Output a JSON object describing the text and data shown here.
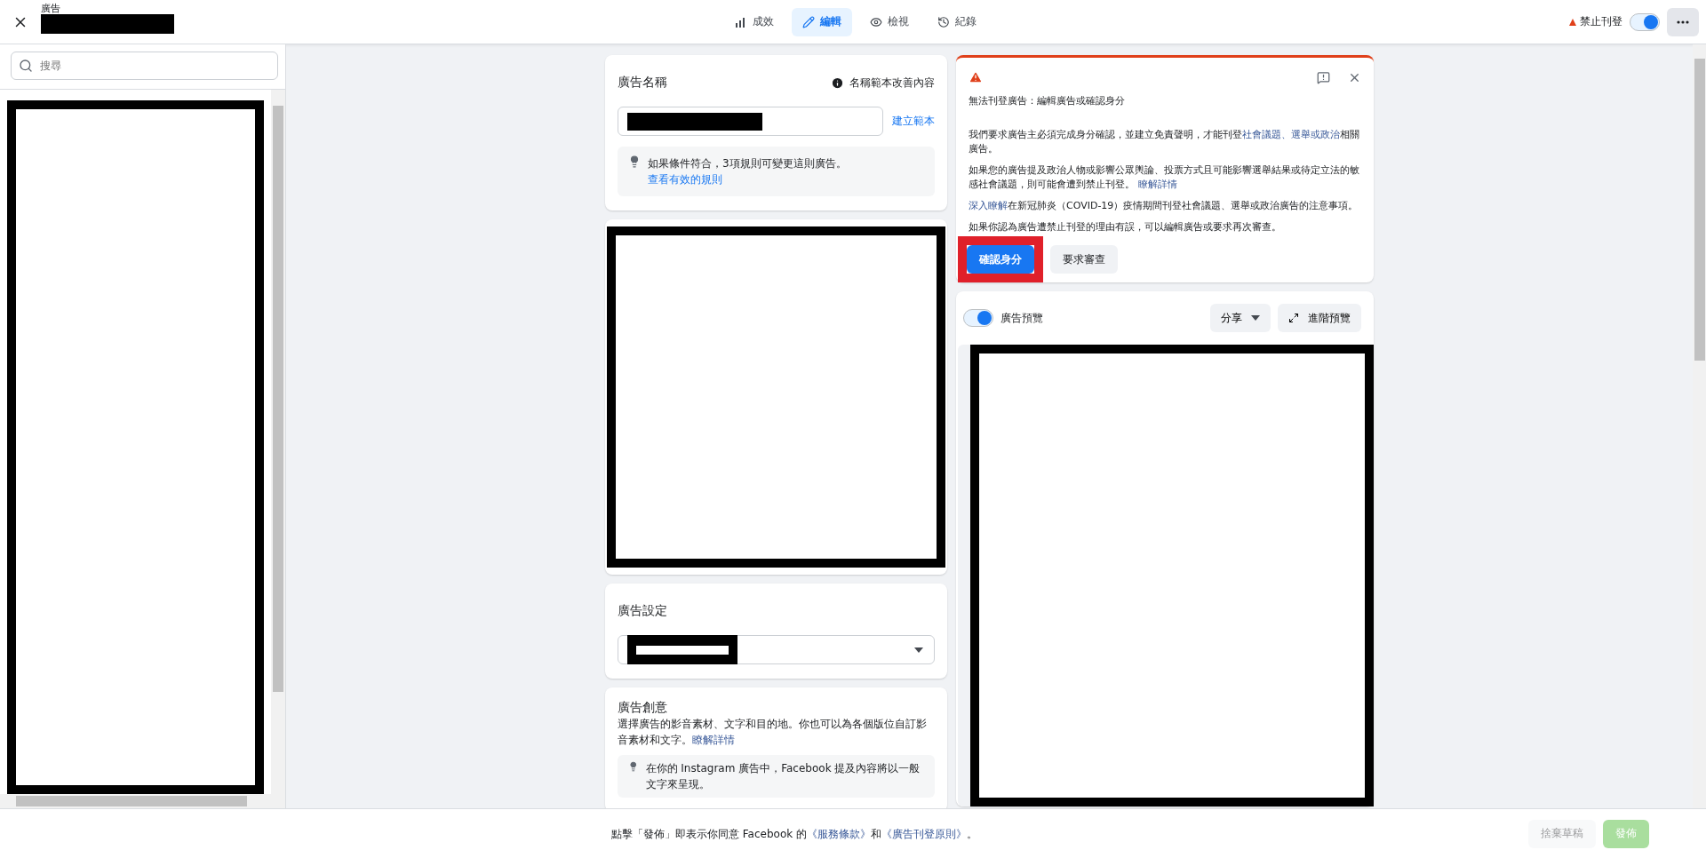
{
  "header": {
    "title": "廣告",
    "tabs": [
      {
        "label": "成效",
        "kind": "chart",
        "selected": false
      },
      {
        "label": "編輯",
        "kind": "pencil",
        "selected": true
      },
      {
        "label": "檢視",
        "kind": "eye",
        "selected": false
      },
      {
        "label": "紀錄",
        "kind": "history",
        "selected": false
      }
    ],
    "status": "禁止刊登",
    "toggle_on": true
  },
  "sidebar": {
    "search_placeholder": "搜尋"
  },
  "name_card": {
    "title": "廣告名稱",
    "info_link": "名稱範本改善內容",
    "template_link": "建立範本",
    "tip": "如果條件符合，3項規則可變更這則廣告。",
    "tip_link": "查看有效的規則"
  },
  "settings_card": {
    "title": "廣告設定"
  },
  "creative_card": {
    "title": "廣告創意",
    "description": [
      {
        "text": "選擇廣告的影音素材、文字和目的地。你也可以為各個版位自訂影音素材和文字。",
        "link": false
      },
      {
        "text": "瞭解詳情",
        "link": true
      }
    ],
    "tip": "在你的 Instagram 廣告中，Facebook 提及內容將以一般文字來呈現。"
  },
  "notice": {
    "title": "無法刊登廣告：編輯廣告或確認身分",
    "paragraphs": [
      [
        {
          "text": "我們要求廣告主必須完成身分確認，並建立免責聲明，才能刊登",
          "link": false
        },
        {
          "text": "社會議題、選舉或政治",
          "link": true
        },
        {
          "text": "相關廣告。",
          "link": false
        }
      ],
      [
        {
          "text": "如果您的廣告提及政治人物或影響公眾輿論、投票方式且可能影響選舉結果或待定立法的敏感社會議題，則可能會遭到禁止刊登。 ",
          "link": false
        },
        {
          "text": "瞭解詳情",
          "link": true
        }
      ],
      [
        {
          "text": "深入瞭解",
          "link": true
        },
        {
          "text": "在新冠肺炎（COVID-19）疫情期間刊登社會議題、選舉或政治廣告的注意事項。",
          "link": false
        }
      ],
      [
        {
          "text": "如果你認為廣告遭禁止刊登的理由有誤，可以編輯廣告或要求再次審查。",
          "link": false
        }
      ]
    ],
    "buttons": [
      {
        "label": "確認身分",
        "kind": "primary",
        "highlighted": true
      },
      {
        "label": "要求審查",
        "kind": "secondary",
        "highlighted": false
      }
    ]
  },
  "preview": {
    "label": "廣告預覽",
    "on": true,
    "share": "分享",
    "advanced": "進階預覽"
  },
  "footer": {
    "text": [
      {
        "text": "點擊「發佈」即表示你同意 Facebook 的",
        "link": false
      },
      {
        "text": "《服務條款》",
        "link": true
      },
      {
        "text": "和",
        "link": false
      },
      {
        "text": "《廣告刊登原則》",
        "link": true
      },
      {
        "text": "。",
        "link": false
      }
    ],
    "buttons": [
      {
        "label": "捨棄草稿",
        "kind": "secondary",
        "disabled": true
      },
      {
        "label": "發佈",
        "kind": "publish",
        "disabled": true
      }
    ]
  }
}
